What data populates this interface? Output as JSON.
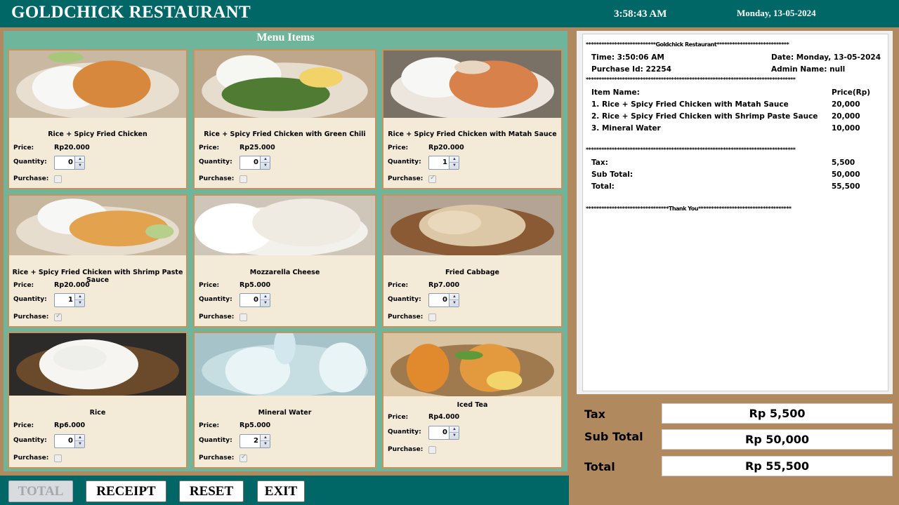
{
  "header": {
    "title": "GOLDCHICK RESTAURANT",
    "clock": "3:58:43 AM",
    "date": "Monday, 13-05-2024"
  },
  "menu": {
    "title": "Menu Items",
    "price_label": "Price:",
    "quantity_label": "Quantity:",
    "purchase_label": "Purchase:",
    "items": [
      {
        "name": "Rice + Spicy Fried Chicken",
        "price": "Rp20.000",
        "quantity": "0",
        "purchased": false
      },
      {
        "name": "Rice + Spicy Fried Chicken with Green Chili",
        "price": "Rp25.000",
        "quantity": "0",
        "purchased": false
      },
      {
        "name": "Rice + Spicy Fried Chicken with Matah Sauce",
        "price": "Rp20.000",
        "quantity": "1",
        "purchased": true
      },
      {
        "name": "Rice + Spicy Fried Chicken with Shrimp Paste Sauce",
        "price": "Rp20.000",
        "quantity": "1",
        "purchased": true
      },
      {
        "name": "Mozzarella Cheese",
        "price": "Rp5.000",
        "quantity": "0",
        "purchased": false
      },
      {
        "name": "Fried Cabbage",
        "price": "Rp7.000",
        "quantity": "0",
        "purchased": false
      },
      {
        "name": "Rice",
        "price": "Rp6.000",
        "quantity": "0",
        "purchased": false
      },
      {
        "name": "Mineral Water",
        "price": "Rp5.000",
        "quantity": "2",
        "purchased": true
      },
      {
        "name": "Iced Tea",
        "price": "Rp4.000",
        "quantity": "0",
        "purchased": false
      }
    ]
  },
  "buttons": {
    "total": "TOTAL",
    "receipt": "RECEIPT",
    "reset": "RESET",
    "exit": "EXIT"
  },
  "receipt": {
    "header_line": "***************************Goldchick Restaurant****************************",
    "time": "Time: 3:50:06 AM",
    "date": "Date: Monday, 13-05-2024",
    "purchase_id": "Purchase Id: 22254",
    "admin": "Admin Name: null",
    "separator": "*********************************************************************************",
    "item_name_label": "Item Name:",
    "price_label": "Price(Rp)",
    "lines": [
      {
        "name": "1. Rice + Spicy Fried Chicken with Matah Sauce",
        "price": "20,000"
      },
      {
        "name": "2. Rice + Spicy Fried Chicken with Shrimp Paste Sauce",
        "price": "20,000"
      },
      {
        "name": "3. Mineral Water",
        "price": "10,000"
      }
    ],
    "tax_label": "Tax:",
    "tax": "5,500",
    "subtotal_label": "Sub Total:",
    "subtotal": "50,000",
    "total_label": "Total:",
    "total": "55,500",
    "footer_line": "********************************Thank You************************************"
  },
  "totals": {
    "tax_label": "Tax",
    "tax": "Rp 5,500",
    "subtotal_label": "Sub Total",
    "subtotal": "Rp 50,000",
    "total_label": "Total",
    "total": "Rp 55,500"
  }
}
